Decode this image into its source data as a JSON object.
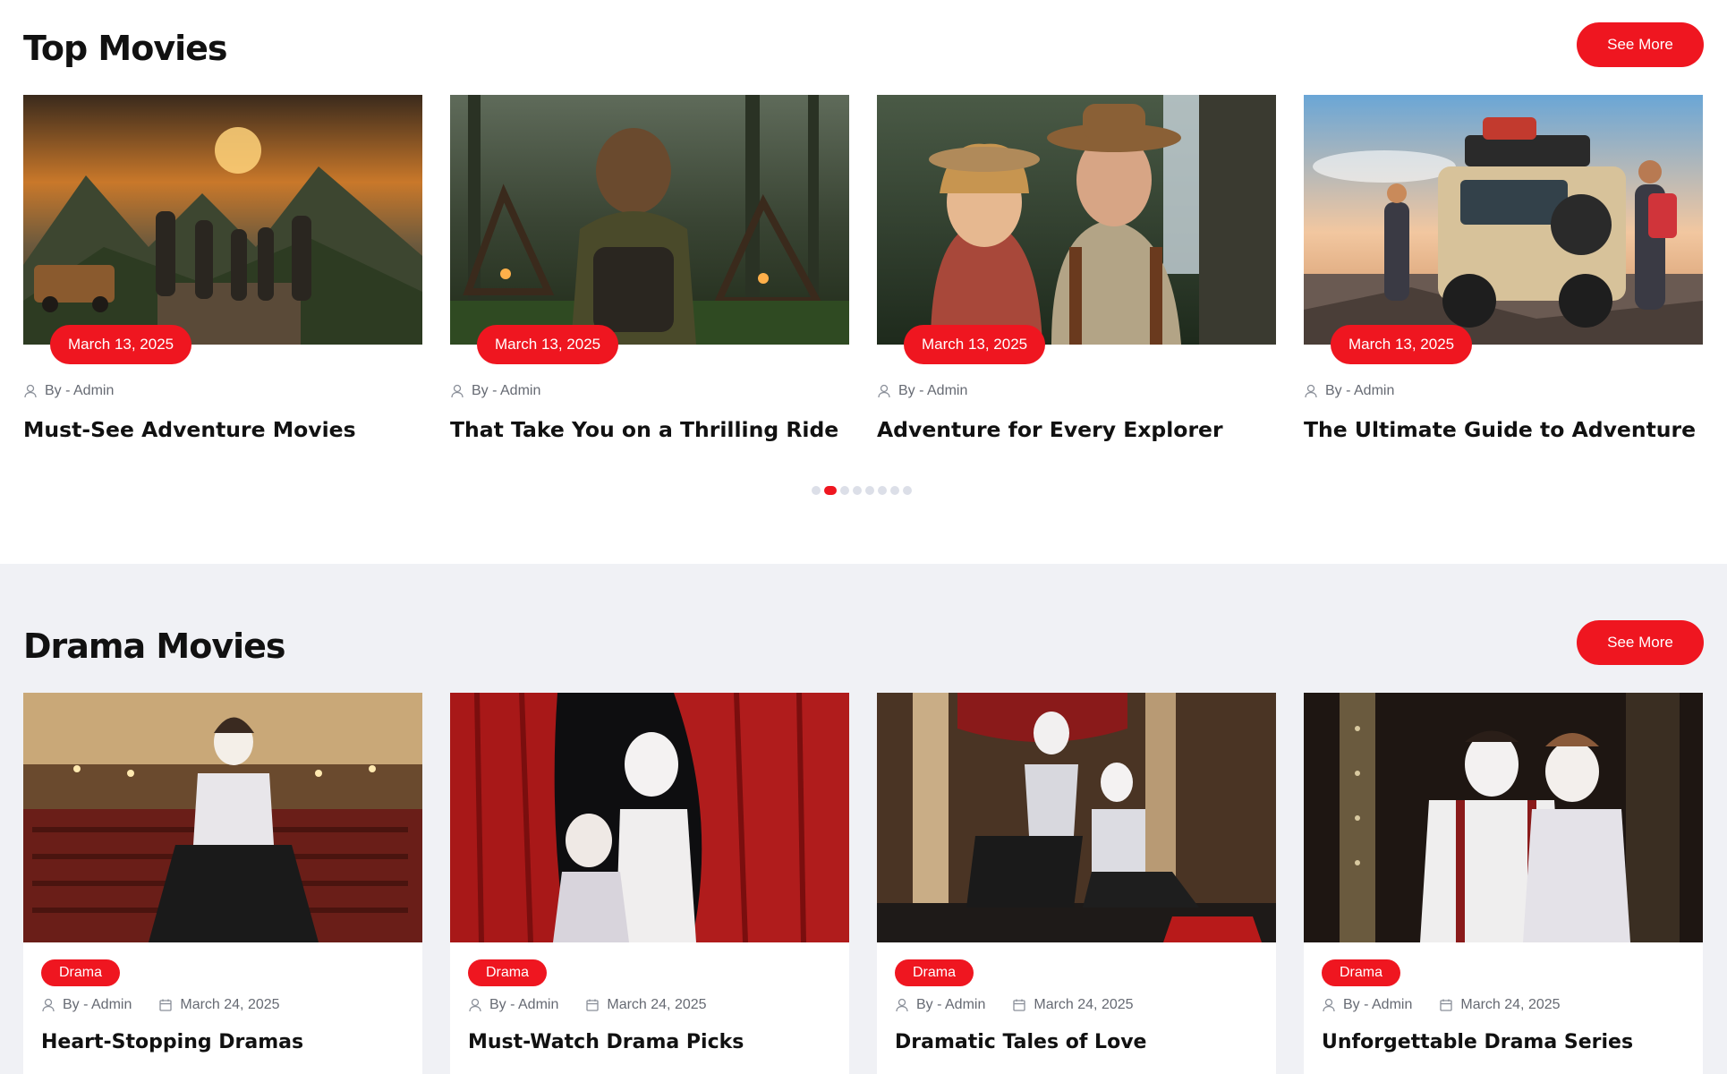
{
  "brand": {
    "accent": "#ef1620",
    "section_bg": "#f0f1f5"
  },
  "top_movies": {
    "title": "Top Movies",
    "see_more": "See More",
    "cards": [
      {
        "date": "March 13, 2025",
        "author": "By - Admin",
        "title": "Must-See Adventure Movies",
        "image": "mountain-hikers-scene"
      },
      {
        "date": "March 13, 2025",
        "author": "By - Admin",
        "title": "That Take You on a Thrilling Ride",
        "image": "forest-child-camp-scene"
      },
      {
        "date": "March 13, 2025",
        "author": "By - Admin",
        "title": "Adventure for Every Explorer",
        "image": "explorer-couple-waterfall-scene"
      },
      {
        "date": "March 13, 2025",
        "author": "By - Admin",
        "title": "The Ultimate Guide to Adventure",
        "image": "offroad-jeep-coast-scene"
      }
    ],
    "pager": {
      "total": 8,
      "active": 2
    }
  },
  "drama_movies": {
    "title": "Drama Movies",
    "see_more": "See More",
    "cards": [
      {
        "category": "Drama",
        "author": "By - Admin",
        "date": "March 24, 2025",
        "title": "Heart-Stopping Dramas",
        "image": "mime-theater-hall-scene"
      },
      {
        "category": "Drama",
        "author": "By - Admin",
        "date": "March 24, 2025",
        "title": "Must-Watch Drama Picks",
        "image": "mimes-red-curtain-scene"
      },
      {
        "category": "Drama",
        "author": "By - Admin",
        "date": "March 24, 2025",
        "title": "Dramatic Tales of Love",
        "image": "mimes-stage-scene"
      },
      {
        "category": "Drama",
        "author": "By - Admin",
        "date": "March 24, 2025",
        "title": "Unforgettable Drama Series",
        "image": "mime-couple-scene"
      }
    ]
  }
}
